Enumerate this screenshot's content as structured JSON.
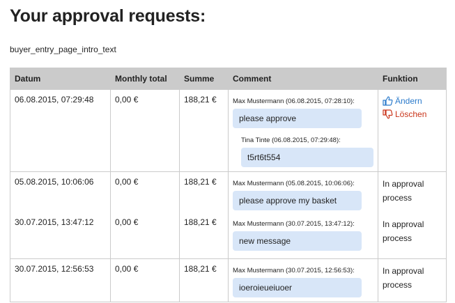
{
  "page": {
    "title": "Your approval requests:",
    "intro": "buyer_entry_page_intro_text"
  },
  "table": {
    "headers": {
      "date": "Datum",
      "monthly_total": "Monthly total",
      "sum": "Summe",
      "comment": "Comment",
      "function": "Funktion"
    },
    "rows": [
      {
        "date": "06.08.2015, 07:29:48",
        "monthly_total": "0,00 €",
        "sum": "188,21 €",
        "comment_meta": "Max Mustermann (06.08.2015, 07:28:10):",
        "comment_text": "please approve",
        "reply_meta": "Tina Tinte (06.08.2015, 07:29:48):",
        "reply_text": "t5rt6t554",
        "edit_label": "Ändern",
        "delete_label": "Löschen"
      },
      {
        "date": "05.08.2015, 10:06:06",
        "monthly_total": "0,00 €",
        "sum": "188,21 €",
        "comment_meta": "Max Mustermann (05.08.2015, 10:06:06):",
        "comment_text": "please approve my basket",
        "status": "In approval process"
      },
      {
        "date": "30.07.2015, 13:47:12",
        "monthly_total": "0,00 €",
        "sum": "188,21 €",
        "comment_meta": "Max Mustermann (30.07.2015, 13:47:12):",
        "comment_text": "new message",
        "status": "In approval process"
      },
      {
        "date": "30.07.2015, 12:56:53",
        "monthly_total": "0,00 €",
        "sum": "188,21 €",
        "comment_meta": "Max Mustermann (30.07.2015, 12:56:53):",
        "comment_text": "ioeroieueiuoer",
        "status": "In approval process"
      }
    ]
  },
  "icons": {
    "edit": "thumbs-up-icon",
    "delete": "thumbs-down-icon"
  },
  "colors": {
    "header_bg": "#cbcbcb",
    "bubble_bg": "#d8e6f8",
    "edit_link": "#2a7acb",
    "delete_link": "#c9341a"
  }
}
